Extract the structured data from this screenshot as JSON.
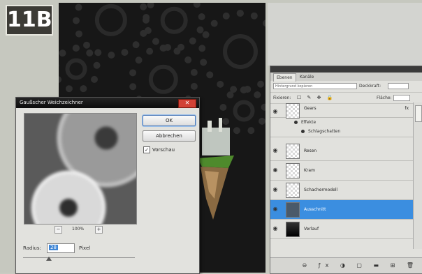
{
  "badge": {
    "label": "11B"
  },
  "dialog": {
    "title": "Gaußscher Weichzeichner",
    "close_symbol": "✕",
    "ok_label": "OK",
    "cancel_label": "Abbrechen",
    "preview_checked": true,
    "preview_label": "Vorschau",
    "zoom_out_symbol": "−",
    "zoom_in_symbol": "+",
    "zoom_level": "100%",
    "radius_label": "Radius:",
    "radius_value": "28",
    "radius_unit": "Pixel"
  },
  "layers_panel": {
    "tabs": [
      {
        "label": "Ebenen"
      },
      {
        "label": "Kanäle"
      }
    ],
    "blend_mode": "Hintergrund kopieren",
    "opacity_label": "Deckkraft:",
    "opacity_value": "",
    "lock_label": "Fixieren:",
    "lock_icons": "☐ ✎ ✥ 🔒",
    "fill_label": "Fläche:",
    "fill_value": "",
    "top_layer": {
      "name": "Gears",
      "fx": "fx"
    },
    "effects_label": "Effekte",
    "shadow_label": "Schlagschatten",
    "layers": [
      {
        "name": "Resen",
        "selected": false
      },
      {
        "name": "Kram",
        "selected": false
      },
      {
        "name": "Schachermodell",
        "selected": false
      },
      {
        "name": "Ausschnitt",
        "selected": true
      },
      {
        "name": "Verlauf",
        "selected": false
      }
    ],
    "bottom_icons": "⊖ ƒx ◑ ▢ ▬ ⊞ 🗑"
  }
}
